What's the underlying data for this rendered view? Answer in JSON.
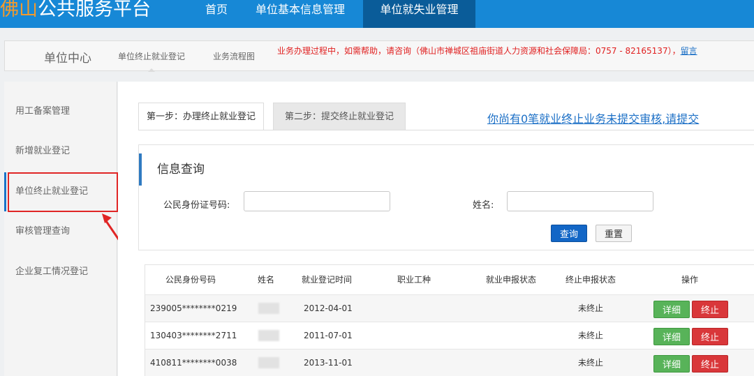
{
  "header": {
    "logo_accent": "佛山",
    "logo_rest": "公共服务平台",
    "nav": [
      "首页",
      "单位基本信息管理",
      "单位就失业管理"
    ]
  },
  "subheader": {
    "title": "单位中心",
    "links": [
      "单位终止就业登记",
      "业务流程图"
    ],
    "notice": "业务办理过程中，如需帮助，请咨询（佛山市禅城区祖庙街道人力资源和社会保障局：0757 - 82165137），",
    "notice_link": "留言"
  },
  "sidebar": {
    "items": [
      "用工备案管理",
      "新增就业登记",
      "单位终止就业登记",
      "审核管理查询",
      "企业复工情况登记"
    ]
  },
  "tabs": {
    "step1": "第一步：办理终止就业登记",
    "step2": "第二步：提交终止就业登记",
    "pending": "你尚有0笔就业终止业务未提交审核,请提交"
  },
  "query": {
    "title": "信息查询",
    "id_label": "公民身份证号码:",
    "id_value": "",
    "name_label": "姓名:",
    "name_value": "",
    "search_label": "查询",
    "reset_label": "重置"
  },
  "table": {
    "headers": [
      "公民身份号码",
      "姓名",
      "就业登记时间",
      "职业工种",
      "就业申报状态",
      "终止申报状态",
      "操作"
    ],
    "rows": [
      {
        "id": "239005********0219",
        "name": "",
        "date": "2012-04-01",
        "job": "",
        "emp_status": "",
        "stop_status": "未终止"
      },
      {
        "id": "130403********2711",
        "name": "",
        "date": "2011-07-01",
        "job": "",
        "emp_status": "",
        "stop_status": "未终止"
      },
      {
        "id": "410811********0038",
        "name": "",
        "date": "2013-11-01",
        "job": "",
        "emp_status": "",
        "stop_status": "未终止"
      }
    ],
    "detail_label": "详细",
    "stop_label": "终止"
  },
  "colors": {
    "nav_bg": "#1788d6",
    "nav_active": "#0a5c99",
    "logo_accent": "#f39a2d",
    "notice_red": "#e02020",
    "link_blue": "#1b6fc6",
    "btn_green": "#58b359",
    "btn_red": "#d9373a",
    "btn_blue": "#1266c6"
  }
}
